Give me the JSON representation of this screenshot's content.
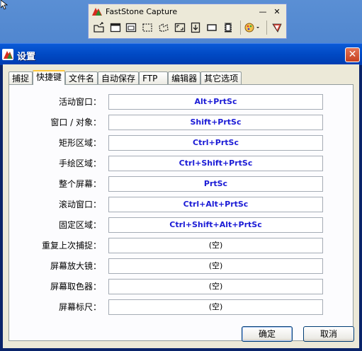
{
  "toolbar": {
    "title": "FastStone Capture",
    "minimize": "—",
    "close": "✕",
    "tools": [
      "open-icon",
      "capture-window-icon",
      "capture-object-icon",
      "capture-region-icon",
      "capture-freehand-icon",
      "capture-fullscreen-icon",
      "capture-scrolling-icon",
      "capture-fixed-region-icon",
      "record-video-icon",
      "output-icon",
      "settings-icon"
    ]
  },
  "dialog": {
    "title": "设置",
    "close": "✕",
    "tabs": [
      "捕捉",
      "快捷键",
      "文件名",
      "自动保存",
      "FTP",
      "编辑器",
      "其它选项"
    ],
    "active_tab": "快捷键",
    "hotkeys": [
      {
        "label": "活动窗口：",
        "value": "Alt+PrtSc"
      },
      {
        "label": "窗口 / 对象：",
        "value": "Shift+PrtSc"
      },
      {
        "label": "矩形区域：",
        "value": "Ctrl+PrtSc"
      },
      {
        "label": "手绘区域：",
        "value": "Ctrl+Shift+PrtSc"
      },
      {
        "label": "整个屏幕：",
        "value": "PrtSc"
      },
      {
        "label": "滚动窗口：",
        "value": "Ctrl+Alt+PrtSc"
      },
      {
        "label": "固定区域：",
        "value": "Ctrl+Shift+Alt+PrtSc"
      },
      {
        "label": "重复上次捕捉：",
        "value": "(空)"
      },
      {
        "label": "屏幕放大镜：",
        "value": "(空)"
      },
      {
        "label": "屏幕取色器：",
        "value": "(空)"
      },
      {
        "label": "屏幕标尺：",
        "value": "(空)"
      }
    ],
    "ok": "确定",
    "cancel": "取消"
  }
}
